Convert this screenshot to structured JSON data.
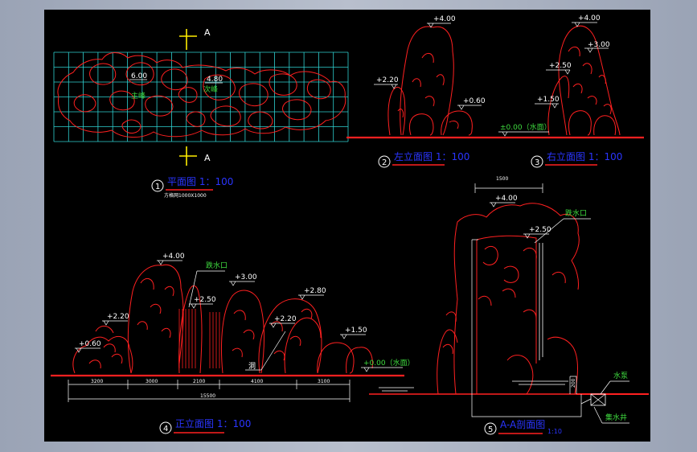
{
  "plan": {
    "section_marker": "A",
    "labels": [
      "6.00",
      "4.80",
      "主峰",
      "次峰"
    ],
    "title_num": "1",
    "title": "平面图 1：100",
    "grid_note": "方格网1000X1000"
  },
  "left_elev": {
    "levels": [
      "+4.00",
      "+2.20",
      "+0.60"
    ],
    "title_num": "2",
    "title": "左立面图 1：100"
  },
  "right_elev": {
    "levels": [
      "+4.00",
      "+3.00",
      "+2.50",
      "+1.50"
    ],
    "water": "±0.00（水面）",
    "title_num": "3",
    "title": "右立面图 1：100"
  },
  "front_elev": {
    "levels": [
      "+4.00",
      "+3.00",
      "+2.50",
      "+2.80",
      "+2.20",
      "+2.20",
      "+1.50",
      "+0.60"
    ],
    "water": "+0.00（水面）",
    "outlet": "跌水口",
    "cave": "洞",
    "dims": [
      "3200",
      "3000",
      "2100",
      "4100",
      "3100"
    ],
    "total": "15500",
    "title_num": "4",
    "title": "正立面图 1：100"
  },
  "section": {
    "top_dim": "1500",
    "levels": [
      "+4.00",
      "+2.50"
    ],
    "outlet": "跌水口",
    "pump": "水泵",
    "well": "集水井",
    "side_dim": "200",
    "title_num": "5",
    "title": "A-A剖面图",
    "scale": "1:10"
  }
}
